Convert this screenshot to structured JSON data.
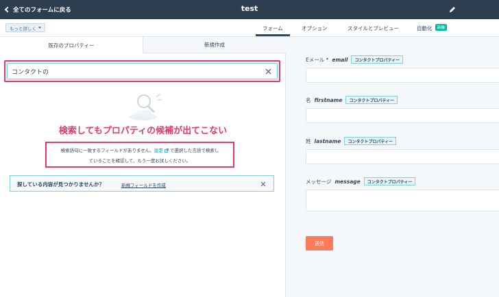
{
  "header": {
    "back_label": "全てのフォームに戻る",
    "title": "test"
  },
  "subbar": {
    "more_label": "もっと詳しく",
    "tabs": [
      {
        "label": "フォーム",
        "active": true
      },
      {
        "label": "オプション",
        "active": false
      },
      {
        "label": "スタイルとプレビュー",
        "active": false
      },
      {
        "label": "自動化",
        "active": false
      }
    ],
    "new_badge": "新機"
  },
  "left": {
    "tabs": [
      {
        "label": "既存のプロパティー",
        "active": true
      },
      {
        "label": "新規作成",
        "active": false
      }
    ],
    "search": {
      "value": "コンタクトの",
      "placeholder": ""
    },
    "annotation": "検索してもプロパティの候補が出てこない",
    "empty_message": {
      "line1_a": "検索語句に一致するフィールドがありません。",
      "link": "設定",
      "line1_b": "で選択した言語で検索し",
      "line2": "ていることを確認して、もう一度お試しください。"
    },
    "help": {
      "question": "探している内容が見つかりませんか？",
      "link": "新規フィールドを作成"
    }
  },
  "right": {
    "fields": [
      {
        "label": "Eメール *",
        "name": "email",
        "tag": "コンタクトプロパティー"
      },
      {
        "label": "名",
        "name": "firstname",
        "tag": "コンタクトプロパティー"
      },
      {
        "label": "姓",
        "name": "lastname",
        "tag": "コンタクトプロパティー"
      },
      {
        "label": "メッセージ",
        "name": "message",
        "tag": "コンタクトプロパティー"
      }
    ],
    "submit_label": "送信"
  },
  "colors": {
    "topbar": "#2d3e50",
    "annotation": "#e4386b",
    "link": "#0091ae",
    "submit": "#ff7a59",
    "badge": "#00bda5"
  }
}
